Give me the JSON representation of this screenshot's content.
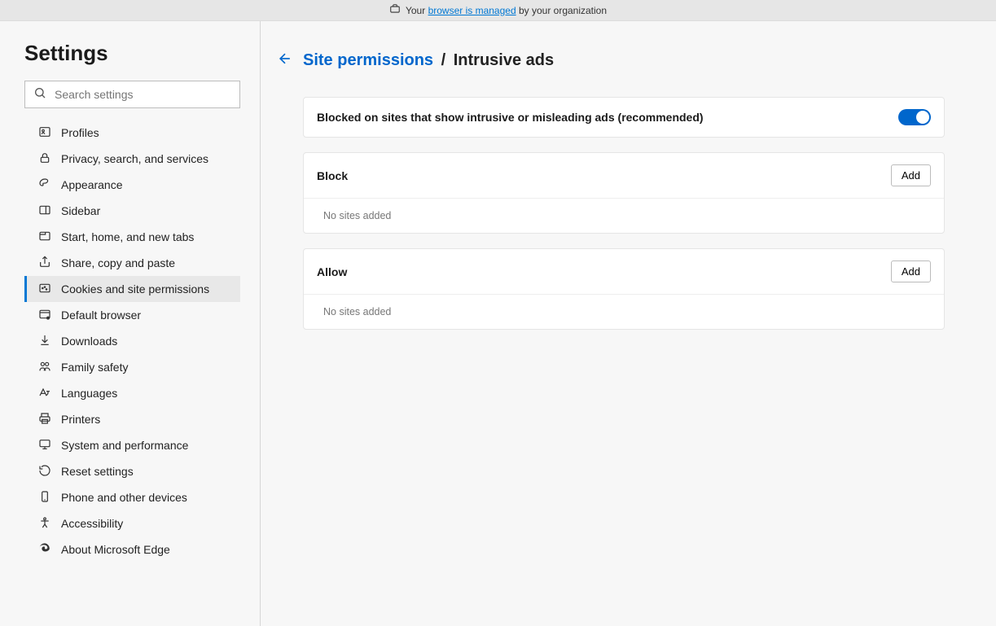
{
  "managed_bar": {
    "prefix": "Your ",
    "link": "browser is managed",
    "suffix": " by your organization"
  },
  "sidebar": {
    "title": "Settings",
    "search_placeholder": "Search settings",
    "items": [
      {
        "id": "profiles",
        "label": "Profiles"
      },
      {
        "id": "privacy",
        "label": "Privacy, search, and services"
      },
      {
        "id": "appearance",
        "label": "Appearance"
      },
      {
        "id": "sidebar",
        "label": "Sidebar"
      },
      {
        "id": "start",
        "label": "Start, home, and new tabs"
      },
      {
        "id": "share",
        "label": "Share, copy and paste"
      },
      {
        "id": "cookies",
        "label": "Cookies and site permissions",
        "selected": true
      },
      {
        "id": "default",
        "label": "Default browser"
      },
      {
        "id": "downloads",
        "label": "Downloads"
      },
      {
        "id": "family",
        "label": "Family safety"
      },
      {
        "id": "languages",
        "label": "Languages"
      },
      {
        "id": "printers",
        "label": "Printers"
      },
      {
        "id": "system",
        "label": "System and performance"
      },
      {
        "id": "reset",
        "label": "Reset settings"
      },
      {
        "id": "phone",
        "label": "Phone and other devices"
      },
      {
        "id": "accessibility",
        "label": "Accessibility"
      },
      {
        "id": "about",
        "label": "About Microsoft Edge"
      }
    ]
  },
  "breadcrumb": {
    "parent": "Site permissions",
    "separator": "/",
    "current": "Intrusive ads"
  },
  "setting": {
    "label": "Blocked on sites that show intrusive or misleading ads (recommended)",
    "enabled": true
  },
  "block": {
    "title": "Block",
    "add_label": "Add",
    "empty": "No sites added"
  },
  "allow": {
    "title": "Allow",
    "add_label": "Add",
    "empty": "No sites added"
  }
}
